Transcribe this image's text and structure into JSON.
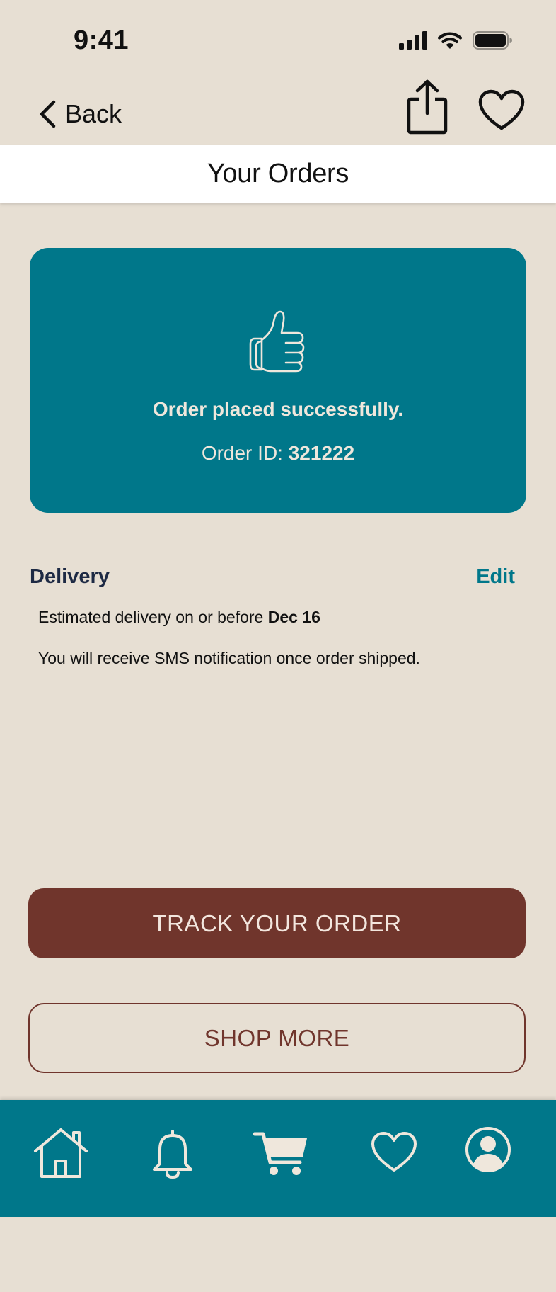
{
  "status_bar": {
    "time": "9:41"
  },
  "nav": {
    "back_label": "Back",
    "share_icon": "share-icon",
    "favorite_icon": "heart-outline-icon"
  },
  "header": {
    "title": "Your Orders"
  },
  "confirmation": {
    "icon": "thumbs-up-icon",
    "message": "Order placed successfully.",
    "order_id_label": "Order ID: ",
    "order_id": "321222"
  },
  "delivery": {
    "heading": "Delivery",
    "edit_label": "Edit",
    "estimate_prefix": "Estimated delivery on or before ",
    "estimate_date": "Dec 16",
    "sms_note": "You will receive SMS notification once order shipped."
  },
  "actions": {
    "track_label": "TRACK YOUR ORDER",
    "shop_more_label": "SHOP MORE"
  },
  "tab_bar": {
    "items": [
      "home-icon",
      "bell-icon",
      "cart-icon",
      "heart-icon",
      "profile-icon"
    ]
  },
  "colors": {
    "background": "#e7dfd3",
    "accent_teal": "#00778a",
    "brand_brown": "#70352c",
    "heading_navy": "#1e2a44",
    "title_bar": "#ffffff"
  }
}
